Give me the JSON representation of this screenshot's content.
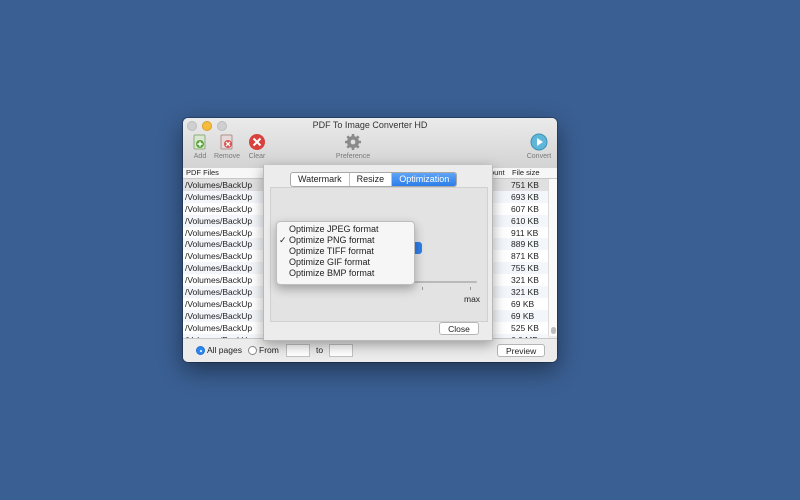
{
  "window": {
    "title": "PDF To Image Converter HD"
  },
  "toolbar": {
    "add": "Add",
    "remove": "Remove",
    "clear": "Clear",
    "preference": "Preference",
    "convert": "Convert"
  },
  "list": {
    "col_files": "PDF Files",
    "col_count": "ount",
    "col_size": "File size",
    "rows": [
      {
        "path": "/Volumes/BackUp",
        "size": "751 KB"
      },
      {
        "path": "/Volumes/BackUp",
        "size": "693 KB"
      },
      {
        "path": "/Volumes/BackUp",
        "size": "607 KB"
      },
      {
        "path": "/Volumes/BackUp",
        "size": "610 KB"
      },
      {
        "path": "/Volumes/BackUp",
        "size": "911 KB"
      },
      {
        "path": "/Volumes/BackUp",
        "size": "889 KB"
      },
      {
        "path": "/Volumes/BackUp",
        "size": "871 KB"
      },
      {
        "path": "/Volumes/BackUp",
        "size": "755 KB"
      },
      {
        "path": "/Volumes/BackUp",
        "size": "321 KB"
      },
      {
        "path": "/Volumes/BackUp",
        "size": "321 KB"
      },
      {
        "path": "/Volumes/BackUp",
        "size": "69 KB"
      },
      {
        "path": "/Volumes/BackUp",
        "size": "69 KB"
      },
      {
        "path": "/Volumes/BackUp",
        "size": "525 KB"
      },
      {
        "path": "/Volumes/BackUp",
        "size": "6.0 MB"
      }
    ]
  },
  "bottom": {
    "all_pages": "All pages",
    "from": "From",
    "to": "to",
    "preview": "Preview"
  },
  "sheet": {
    "tabs": [
      "Watermark",
      "Resize",
      "Optimization"
    ],
    "active_tab": "Optimization",
    "max_label": "max",
    "close": "Close"
  },
  "menu": {
    "items": [
      "Optimize JPEG format",
      "Optimize PNG format",
      "Optimize TIFF format",
      "Optimize GIF format",
      "Optimize BMP format"
    ],
    "checked": "Optimize PNG format",
    "check_mark": "✓"
  }
}
